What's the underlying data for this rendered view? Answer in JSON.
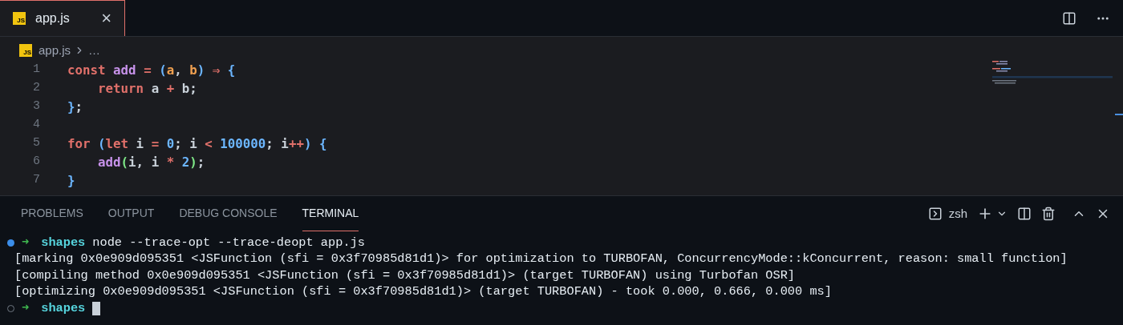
{
  "editor_tabs": [
    {
      "label": "app.js",
      "selected": true,
      "close": "×",
      "icon": "JS"
    }
  ],
  "breadcrumb": {
    "file": "app.js",
    "rest": "…",
    "icon": "JS"
  },
  "code": [
    {
      "number": "1",
      "tokens": [
        {
          "text": "const ",
          "color": "#e0706a"
        },
        {
          "text": "add",
          "color": "#c792ea"
        },
        {
          "text": " = ",
          "color": "#e0706a"
        },
        {
          "text": "(",
          "color": "#6cb6ff"
        },
        {
          "text": "a",
          "color": "#f0a050"
        },
        {
          "text": ", ",
          "color": "#c9d1d9"
        },
        {
          "text": "b",
          "color": "#f0a050"
        },
        {
          "text": ")",
          "color": "#6cb6ff"
        },
        {
          "text": " ⇒ ",
          "color": "#e0706a"
        },
        {
          "text": "{",
          "color": "#6cb6ff"
        }
      ]
    },
    {
      "number": "2",
      "tokens": [
        {
          "text": "    return ",
          "color": "#e0706a"
        },
        {
          "text": "a ",
          "color": "#c9d1d9"
        },
        {
          "text": "+",
          "color": "#e0706a"
        },
        {
          "text": " b;",
          "color": "#c9d1d9"
        }
      ]
    },
    {
      "number": "3",
      "tokens": [
        {
          "text": "}",
          "color": "#6cb6ff"
        },
        {
          "text": ";",
          "color": "#c9d1d9"
        }
      ]
    },
    {
      "number": "4"
    },
    {
      "number": "5",
      "tokens": [
        {
          "text": "for ",
          "color": "#e0706a"
        },
        {
          "text": "(",
          "color": "#6cb6ff"
        },
        {
          "text": "let ",
          "color": "#e0706a"
        },
        {
          "text": "i ",
          "color": "#c9d1d9"
        },
        {
          "text": "= ",
          "color": "#e0706a"
        },
        {
          "text": "0",
          "color": "#6cb6ff"
        },
        {
          "text": "; i ",
          "color": "#c9d1d9"
        },
        {
          "text": "< ",
          "color": "#e0706a"
        },
        {
          "text": "100000",
          "color": "#6cb6ff"
        },
        {
          "text": "; i",
          "color": "#c9d1d9"
        },
        {
          "text": "++",
          "color": "#e0706a"
        },
        {
          "text": ") {",
          "color": "#6cb6ff"
        }
      ]
    },
    {
      "number": "6",
      "tokens": [
        {
          "text": "    add",
          "color": "#c792ea"
        },
        {
          "text": "(",
          "color": "#7ee787"
        },
        {
          "text": "i, i ",
          "color": "#c9d1d9"
        },
        {
          "text": "* ",
          "color": "#e0706a"
        },
        {
          "text": "2",
          "color": "#6cb6ff"
        },
        {
          "text": ")",
          "color": "#7ee787"
        },
        {
          "text": ";",
          "color": "#c9d1d9"
        }
      ]
    },
    {
      "number": "7",
      "tokens": [
        {
          "text": "}",
          "color": "#6cb6ff"
        }
      ]
    }
  ],
  "panel_tabs": [
    {
      "label": "PROBLEMS",
      "selected": false
    },
    {
      "label": "OUTPUT",
      "selected": false
    },
    {
      "label": "DEBUG CONSOLE",
      "selected": false
    },
    {
      "label": "TERMINAL",
      "selected": true
    }
  ],
  "terminal_name": "zsh",
  "terminal": [
    {
      "kind": "prompt",
      "done": true,
      "arrow": "➜",
      "dir": "shapes",
      "command": "node --trace-opt --trace-deopt app.js"
    },
    {
      "kind": "output",
      "text": "[marking 0x0e909d095351 <JSFunction (sfi = 0x3f70985d81d1)> for optimization to TURBOFAN, ConcurrencyMode::kConcurrent, reason: small function]"
    },
    {
      "kind": "output",
      "text": "[compiling method 0x0e909d095351 <JSFunction (sfi = 0x3f70985d81d1)> (target TURBOFAN) using Turbofan OSR]"
    },
    {
      "kind": "output",
      "text": "[optimizing 0x0e909d095351 <JSFunction (sfi = 0x3f70985d81d1)> (target TURBOFAN) - took 0.000, 0.666, 0.000 ms]"
    },
    {
      "kind": "prompt",
      "done": false,
      "arrow": "➜",
      "dir": "shapes"
    }
  ]
}
